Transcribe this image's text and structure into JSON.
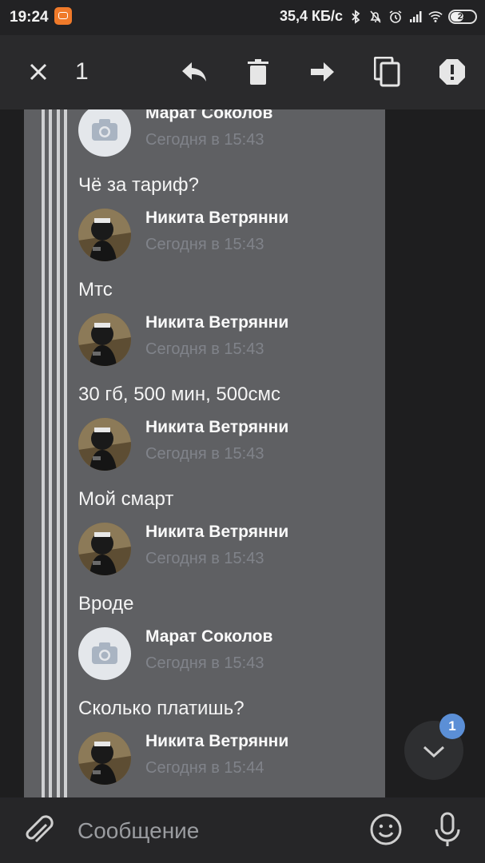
{
  "status_bar": {
    "time": "19:24",
    "network_speed": "35,4 КБ/с",
    "battery_level": "24",
    "icons": [
      "bluetooth-icon",
      "mute-icon",
      "alarm-icon",
      "signal-icon",
      "wifi-icon",
      "battery-icon"
    ]
  },
  "toolbar": {
    "selected_count": "1",
    "actions": [
      "close-icon",
      "reply-icon",
      "delete-icon",
      "forward-icon",
      "copy-icon",
      "report-icon"
    ]
  },
  "messages": [
    {
      "author": "Марат Соколов",
      "time": "Сегодня в 15:43",
      "text": "Чё за тариф?",
      "avatar": "camera-placeholder"
    },
    {
      "author": "Никита Ветрянни",
      "time": "Сегодня в 15:43",
      "text": "Мтс",
      "avatar": "user-photo"
    },
    {
      "author": "Никита Ветрянни",
      "time": "Сегодня в 15:43",
      "text": "30 гб, 500 мин, 500смс",
      "avatar": "user-photo"
    },
    {
      "author": "Никита Ветрянни",
      "time": "Сегодня в 15:43",
      "text": "Мой смарт",
      "avatar": "user-photo"
    },
    {
      "author": "Никита Ветрянни",
      "time": "Сегодня в 15:43",
      "text": "Вроде",
      "avatar": "user-photo"
    },
    {
      "author": "Марат Соколов",
      "time": "Сегодня в 15:43",
      "text": "Сколько платишь?",
      "avatar": "camera-placeholder"
    },
    {
      "author": "Никита Ветрянни",
      "time": "Сегодня в 15:44",
      "text": "",
      "avatar": "user-photo"
    }
  ],
  "scroll_down": {
    "unread_count": "1"
  },
  "composer": {
    "placeholder": "Сообщение"
  },
  "colors": {
    "badge": "#5b8fd6",
    "selection_panel": "#5f6063",
    "toolbar": "#2a2a2c"
  }
}
